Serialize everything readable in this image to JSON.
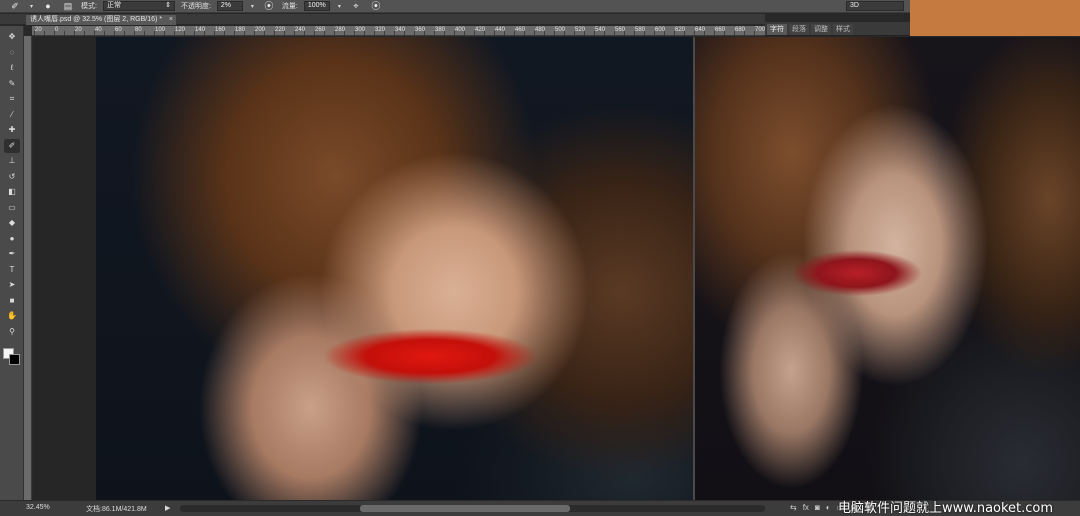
{
  "options_bar": {
    "mode_label": "模式:",
    "mode_value": "正常",
    "opacity_label": "不透明度:",
    "opacity_value": "2%",
    "flow_label": "流量:",
    "flow_value": "100%",
    "workspace_value": "3D"
  },
  "document": {
    "tab_title": "诱人嘴唇.psd @ 32.5% (图层 2, RGB/16) *",
    "close_glyph": "×"
  },
  "ruler": {
    "labels": [
      "20",
      "10",
      "0",
      "10",
      "20",
      "30",
      "40",
      "50",
      "60",
      "70",
      "80",
      "90",
      "100",
      "110",
      "120",
      "130",
      "140",
      "150",
      "160",
      "170",
      "180",
      "190",
      "200",
      "210",
      "220",
      "230",
      "240",
      "250",
      "260",
      "270",
      "280",
      "290",
      "300",
      "310",
      "320",
      "330",
      "340",
      "350",
      "360",
      "370",
      "380",
      "390",
      "400",
      "410",
      "420",
      "430",
      "440",
      "450",
      "460",
      "470",
      "480",
      "490",
      "500",
      "510",
      "520",
      "530",
      "540",
      "550",
      "560",
      "570",
      "580",
      "590",
      "600",
      "610",
      "620",
      "630",
      "640",
      "650",
      "660",
      "670",
      "680",
      "690",
      "700"
    ]
  },
  "panel_tabs": [
    "字符",
    "段落",
    "调整",
    "样式"
  ],
  "status": {
    "zoom": "32.45%",
    "doc_info": "文档:86.1M/421.8M",
    "arrow": "▶"
  },
  "panel_icons": [
    "⇆",
    "fx",
    "◙",
    "◐",
    "▭",
    "▤",
    "🗑"
  ],
  "watermark": "电脑软件问题就上www.naoket.com",
  "colors": {
    "accent_orange": "#c57a40",
    "foreground": "#f5f5f5",
    "background": "#000000"
  },
  "tools": [
    {
      "name": "move-tool-icon",
      "glyph": "✥"
    },
    {
      "name": "marquee-tool-icon",
      "glyph": "◌"
    },
    {
      "name": "lasso-tool-icon",
      "glyph": "ℓ"
    },
    {
      "name": "quick-select-tool-icon",
      "glyph": "✎"
    },
    {
      "name": "crop-tool-icon",
      "glyph": "⌗"
    },
    {
      "name": "eyedropper-tool-icon",
      "glyph": "⁄"
    },
    {
      "name": "healing-brush-tool-icon",
      "glyph": "✚"
    },
    {
      "name": "brush-tool-icon",
      "glyph": "✐"
    },
    {
      "name": "clone-stamp-tool-icon",
      "glyph": "⊥"
    },
    {
      "name": "history-brush-tool-icon",
      "glyph": "↺"
    },
    {
      "name": "eraser-tool-icon",
      "glyph": "◧"
    },
    {
      "name": "gradient-tool-icon",
      "glyph": "▭"
    },
    {
      "name": "blur-tool-icon",
      "glyph": "◆"
    },
    {
      "name": "dodge-tool-icon",
      "glyph": "●"
    },
    {
      "name": "pen-tool-icon",
      "glyph": "✒"
    },
    {
      "name": "type-tool-icon",
      "glyph": "T"
    },
    {
      "name": "path-select-tool-icon",
      "glyph": "➤"
    },
    {
      "name": "shape-tool-icon",
      "glyph": "■"
    },
    {
      "name": "hand-tool-icon",
      "glyph": "✋"
    },
    {
      "name": "zoom-tool-icon",
      "glyph": "⚲"
    }
  ]
}
